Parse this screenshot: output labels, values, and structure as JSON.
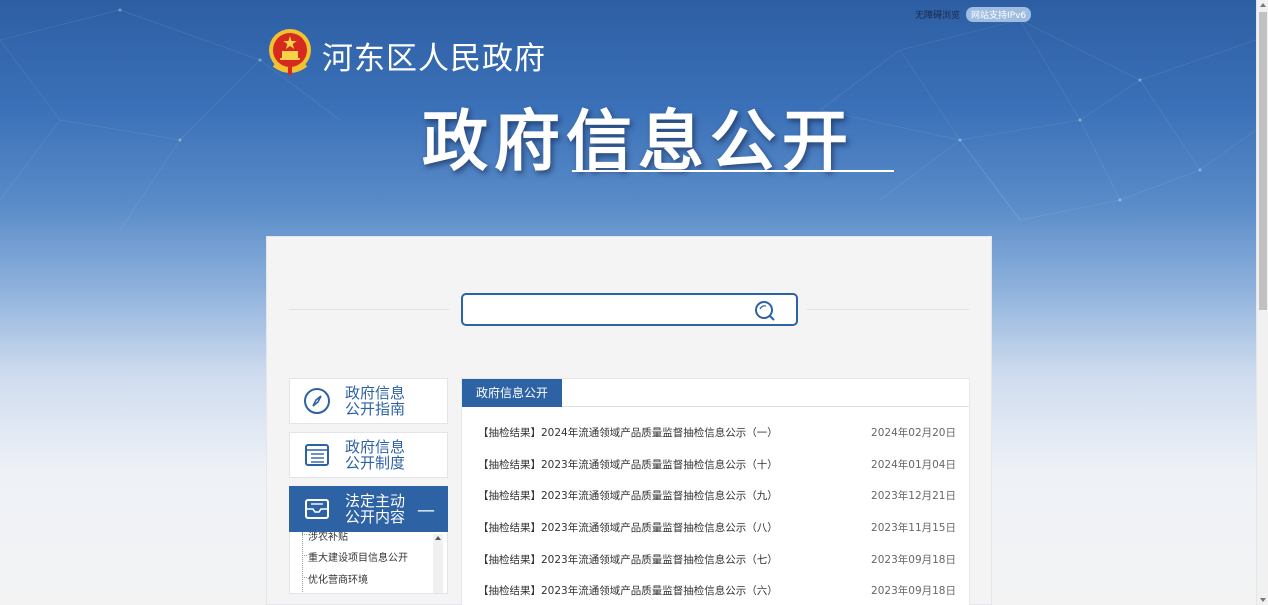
{
  "topbar": {
    "accessible_label": "无障碍浏览",
    "ipv6_label": "网站支持IPv6"
  },
  "header": {
    "site_name": "河东区人民政府",
    "section_title": "政府信息公开"
  },
  "search": {
    "value": "",
    "placeholder": ""
  },
  "sidebar": {
    "items": [
      {
        "label": "政府信息公开指南",
        "icon": "compass-icon",
        "active": false
      },
      {
        "label": "政府信息公开制度",
        "icon": "document-list-icon",
        "active": false
      },
      {
        "label": "法定主动公开内容",
        "icon": "inbox-icon",
        "active": true,
        "toggle": "—"
      }
    ],
    "sub_items": [
      {
        "label": "涉农补贴"
      },
      {
        "label": "重大建设项目信息公开"
      },
      {
        "label": "优化营商环境"
      }
    ]
  },
  "content": {
    "tab_label": "政府信息公开",
    "news": [
      {
        "title": "【抽检结果】2024年流通领域产品质量监督抽检信息公示（一）",
        "date": "2024年02月20日"
      },
      {
        "title": "【抽检结果】2023年流通领域产品质量监督抽检信息公示（十）",
        "date": "2024年01月04日"
      },
      {
        "title": "【抽检结果】2023年流通领域产品质量监督抽检信息公示（九）",
        "date": "2023年12月21日"
      },
      {
        "title": "【抽检结果】2023年流通领域产品质量监督抽检信息公示（八）",
        "date": "2023年11月15日"
      },
      {
        "title": "【抽检结果】2023年流通领域产品质量监督抽检信息公示（七）",
        "date": "2023年09月18日"
      },
      {
        "title": "【抽检结果】2023年流通领域产品质量监督抽检信息公示（六）",
        "date": "2023年09月18日"
      }
    ]
  },
  "colors": {
    "brand_blue": "#2d62a5",
    "banner_top": "#2d5ea3"
  }
}
